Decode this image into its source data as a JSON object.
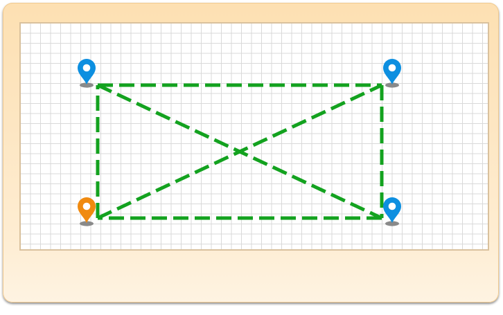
{
  "colors": {
    "line": "#13a21f",
    "pin_blue": "#0d8fe0",
    "pin_orange": "#f08a10",
    "pin_shadow": "#8a8a8a"
  },
  "shape": {
    "type": "rectangle-with-diagonals",
    "line_style": "dashed"
  },
  "pins": [
    {
      "name": "pin-top-left",
      "color": "blue",
      "icon": "map-pin-icon"
    },
    {
      "name": "pin-top-right",
      "color": "blue",
      "icon": "map-pin-icon"
    },
    {
      "name": "pin-bottom-left",
      "color": "orange",
      "icon": "map-pin-icon"
    },
    {
      "name": "pin-bottom-right",
      "color": "blue",
      "icon": "map-pin-icon"
    }
  ]
}
